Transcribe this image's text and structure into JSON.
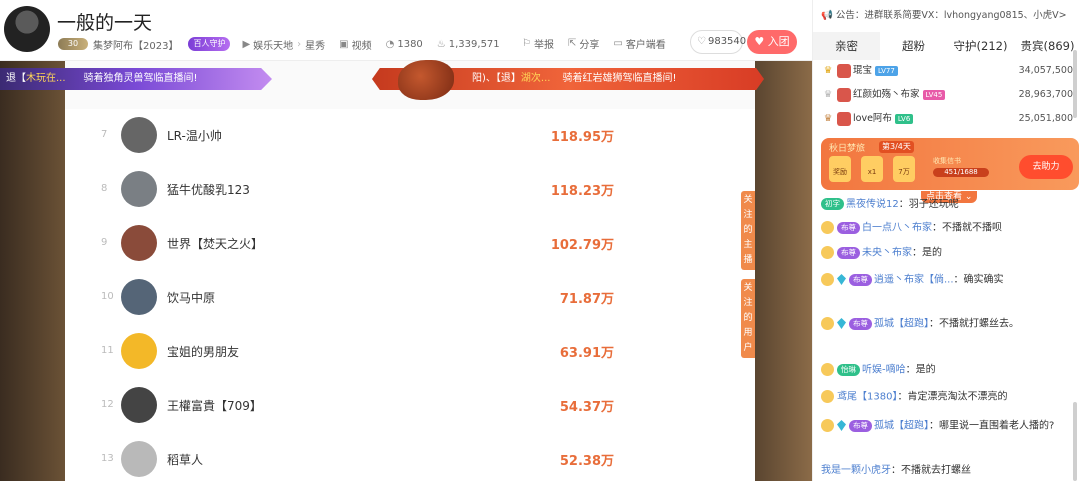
{
  "header": {
    "title": "一般的一天",
    "anchor_level": "30",
    "anchor_name": "集梦阿布【2023】",
    "guard_badge": "百人守护",
    "category": "娱乐天地",
    "subcategory": "星秀",
    "video_label": "视频",
    "followers": "1380",
    "hot": "1,339,571",
    "report": "举报",
    "share": "分享",
    "client": "客户端看",
    "fans": "983540",
    "join_label": "入团"
  },
  "banners": {
    "left_prefix": "退【",
    "left_highlight": "木玩在...",
    "left_text": "骑着独角灵兽驾临直播间!",
    "right_prefix": "阳)、【退】",
    "right_highlight": "湖次...",
    "right_text": "骑着红岩雄狮驾临直播间!"
  },
  "stage_tags": {
    "tag1": "关注的主播",
    "tag2": "关注的用户"
  },
  "ranking": [
    {
      "rank": "7",
      "name": "LR-温小帅",
      "value": "118.95万"
    },
    {
      "rank": "8",
      "name": "猛牛优酸乳123",
      "value": "118.23万"
    },
    {
      "rank": "9",
      "name": "世界【焚天之火】",
      "value": "102.79万"
    },
    {
      "rank": "10",
      "name": "饮马中原",
      "value": "71.87万"
    },
    {
      "rank": "11",
      "name": "宝姐的男朋友",
      "value": "63.91万"
    },
    {
      "rank": "12",
      "name": "王權富貴【709】",
      "value": "54.37万"
    },
    {
      "rank": "13",
      "name": "稻草人",
      "value": "52.38万"
    }
  ],
  "right": {
    "notice": "公告：进群联系简要VX：lvhongyang0815、小虎V>",
    "tabs": [
      "亲密",
      "超粉",
      "守护(212)",
      "贵宾(869)"
    ],
    "top3": [
      {
        "name": "琨宝",
        "tag": "LV77",
        "value": "34,057,500"
      },
      {
        "name": "红颜如殇丶布家",
        "tag": "LV45",
        "value": "28,963,700"
      },
      {
        "name": "love阿布",
        "tag": "LV6",
        "value": "25,051,800"
      }
    ],
    "event": {
      "title": "秋日梦旅",
      "stage": "第3/4天",
      "i1": "奖励",
      "i2": "x1",
      "i3": "7万",
      "book": "收集信书",
      "progress": "451/1688",
      "go": "去助力",
      "tap": "点击查看"
    },
    "chat": [
      {
        "badge": "初字",
        "name": "黑夜传说12",
        "text": "：羽子还玩呢"
      },
      {
        "badge": "布尊",
        "name": "白一点八丶布家",
        "text": "：不播就不播呗"
      },
      {
        "badge": "布尊",
        "name": "未央丶布家",
        "text": "：是的"
      },
      {
        "badge": "布尊",
        "name": "逍遥丶布家【倘...",
        "text": "：确实确实"
      },
      {
        "badge": "布尊",
        "name": "孤城【超跑】",
        "text": "：不播就打螺丝去。"
      },
      {
        "badge": "怡琳",
        "name": "听娱-嘀哈",
        "text": "：是的"
      },
      {
        "badge": "",
        "name": "鸢尾【1380】",
        "text": "：肯定漂亮淘汰不漂亮的"
      },
      {
        "badge": "布尊",
        "name": "孤城【超跑】",
        "text": "：哪里说一直围着老人播的?"
      },
      {
        "badge": "",
        "name": "我是一颗小虎牙",
        "text": "：不播就去打螺丝"
      }
    ]
  }
}
